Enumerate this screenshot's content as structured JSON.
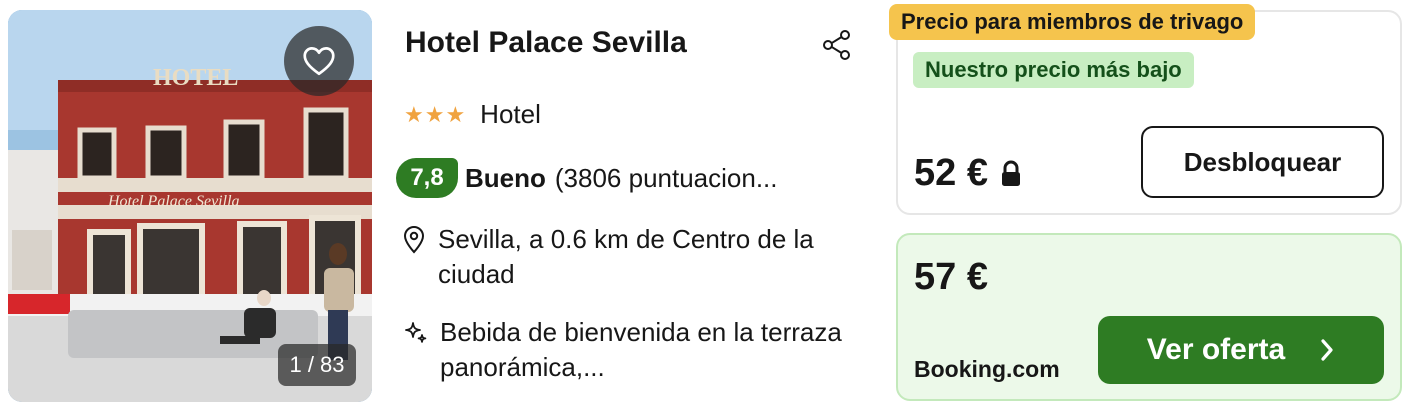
{
  "photo": {
    "counter": "1 / 83",
    "signage": {
      "roof_sign": "HOTEL",
      "facade_sign": "Hotel Palace Sevilla"
    }
  },
  "hotel": {
    "name": "Hotel Palace Sevilla",
    "stars": "★★★",
    "type": "Hotel",
    "rating_score": "7,8",
    "rating_label": "Bueno",
    "rating_count": "(3806 puntuacion...",
    "location": "Sevilla, a 0.6 km de Centro de la ciudad",
    "amenity": "Bebida de bienvenida en la terraza panorámica,..."
  },
  "offers": {
    "member": {
      "tag": "Precio para miembros de trivago",
      "badge": "Nuestro precio más bajo",
      "price": "52 €",
      "button": "Desbloquear"
    },
    "booking": {
      "price": "57 €",
      "provider": "Booking.com",
      "button": "Ver oferta"
    }
  },
  "colors": {
    "rating_green": "#2e7c23",
    "star_orange": "#f0a340",
    "member_yellow": "#f5c44d",
    "lowest_green_bg": "#c8eec2",
    "deal_card_bg": "#ecf9e9"
  }
}
